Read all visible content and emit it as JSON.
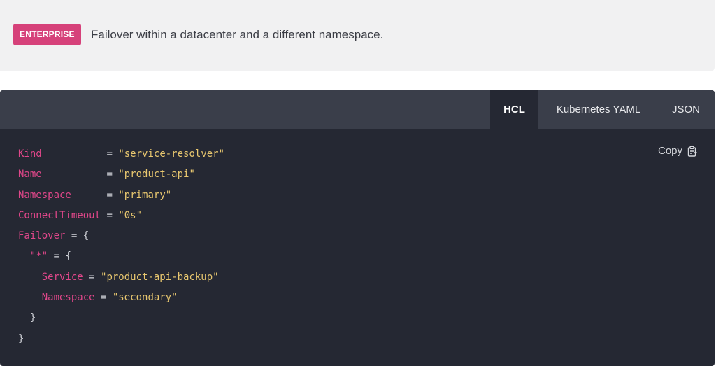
{
  "banner": {
    "badge": "ENTERPRISE",
    "text": "Failover within a datacenter and a different namespace."
  },
  "tabs": [
    {
      "label": "HCL",
      "active": true
    },
    {
      "label": "Kubernetes YAML",
      "active": false
    },
    {
      "label": "JSON",
      "active": false
    }
  ],
  "copy_label": "Copy",
  "code": {
    "l1_key": "Kind",
    "l1_eq": " = ",
    "l1_val": "\"service-resolver\"",
    "l2_key": "Name",
    "l2_eq": " = ",
    "l2_val": "\"product-api\"",
    "l3_key": "Namespace",
    "l3_eq": " = ",
    "l3_val": "\"primary\"",
    "l4_key": "ConnectTimeout",
    "l4_eq": " = ",
    "l4_val": "\"0s\"",
    "l5_key": "Failover",
    "l5_rest": " = {",
    "l6_key": "  \"*\"",
    "l6_rest": " = {",
    "l7_key": "    Service",
    "l7_eq": " = ",
    "l7_val": "\"product-api-backup\"",
    "l8_key": "    Namespace",
    "l8_eq": " = ",
    "l8_val": "\"secondary\"",
    "l9": "  }",
    "l10": "}"
  },
  "colors": {
    "badge": "#d6417a",
    "code_bg": "#252833",
    "tabbar_bg": "#3a3e4a",
    "keyword": "#e0478a",
    "string": "#e8c76f"
  },
  "icons": {
    "copy": "clipboard-icon"
  }
}
